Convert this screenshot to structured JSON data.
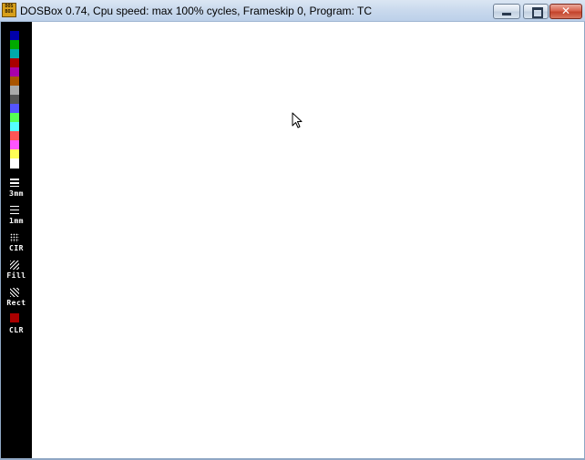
{
  "window": {
    "title": "DOSBox 0.74, Cpu speed: max 100% cycles, Frameskip  0, Program:",
    "program": "TC",
    "icon_lines": [
      "DOS",
      "BOX"
    ],
    "close_glyph": "✕"
  },
  "palette": {
    "colors": [
      "#000000",
      "#0000aa",
      "#00aa00",
      "#00aaaa",
      "#aa0000",
      "#aa00aa",
      "#aa5500",
      "#aaaaaa",
      "#555555",
      "#5555ff",
      "#55ff55",
      "#55ffff",
      "#ff5555",
      "#ff55ff",
      "#ffff55",
      "#ffffff"
    ]
  },
  "tools": {
    "thick": "3mm",
    "thin": "1mm",
    "circle": "CIR",
    "fill": "Fill",
    "rect": "Rect",
    "clear": "CLR",
    "clear_color": "#aa0000"
  }
}
